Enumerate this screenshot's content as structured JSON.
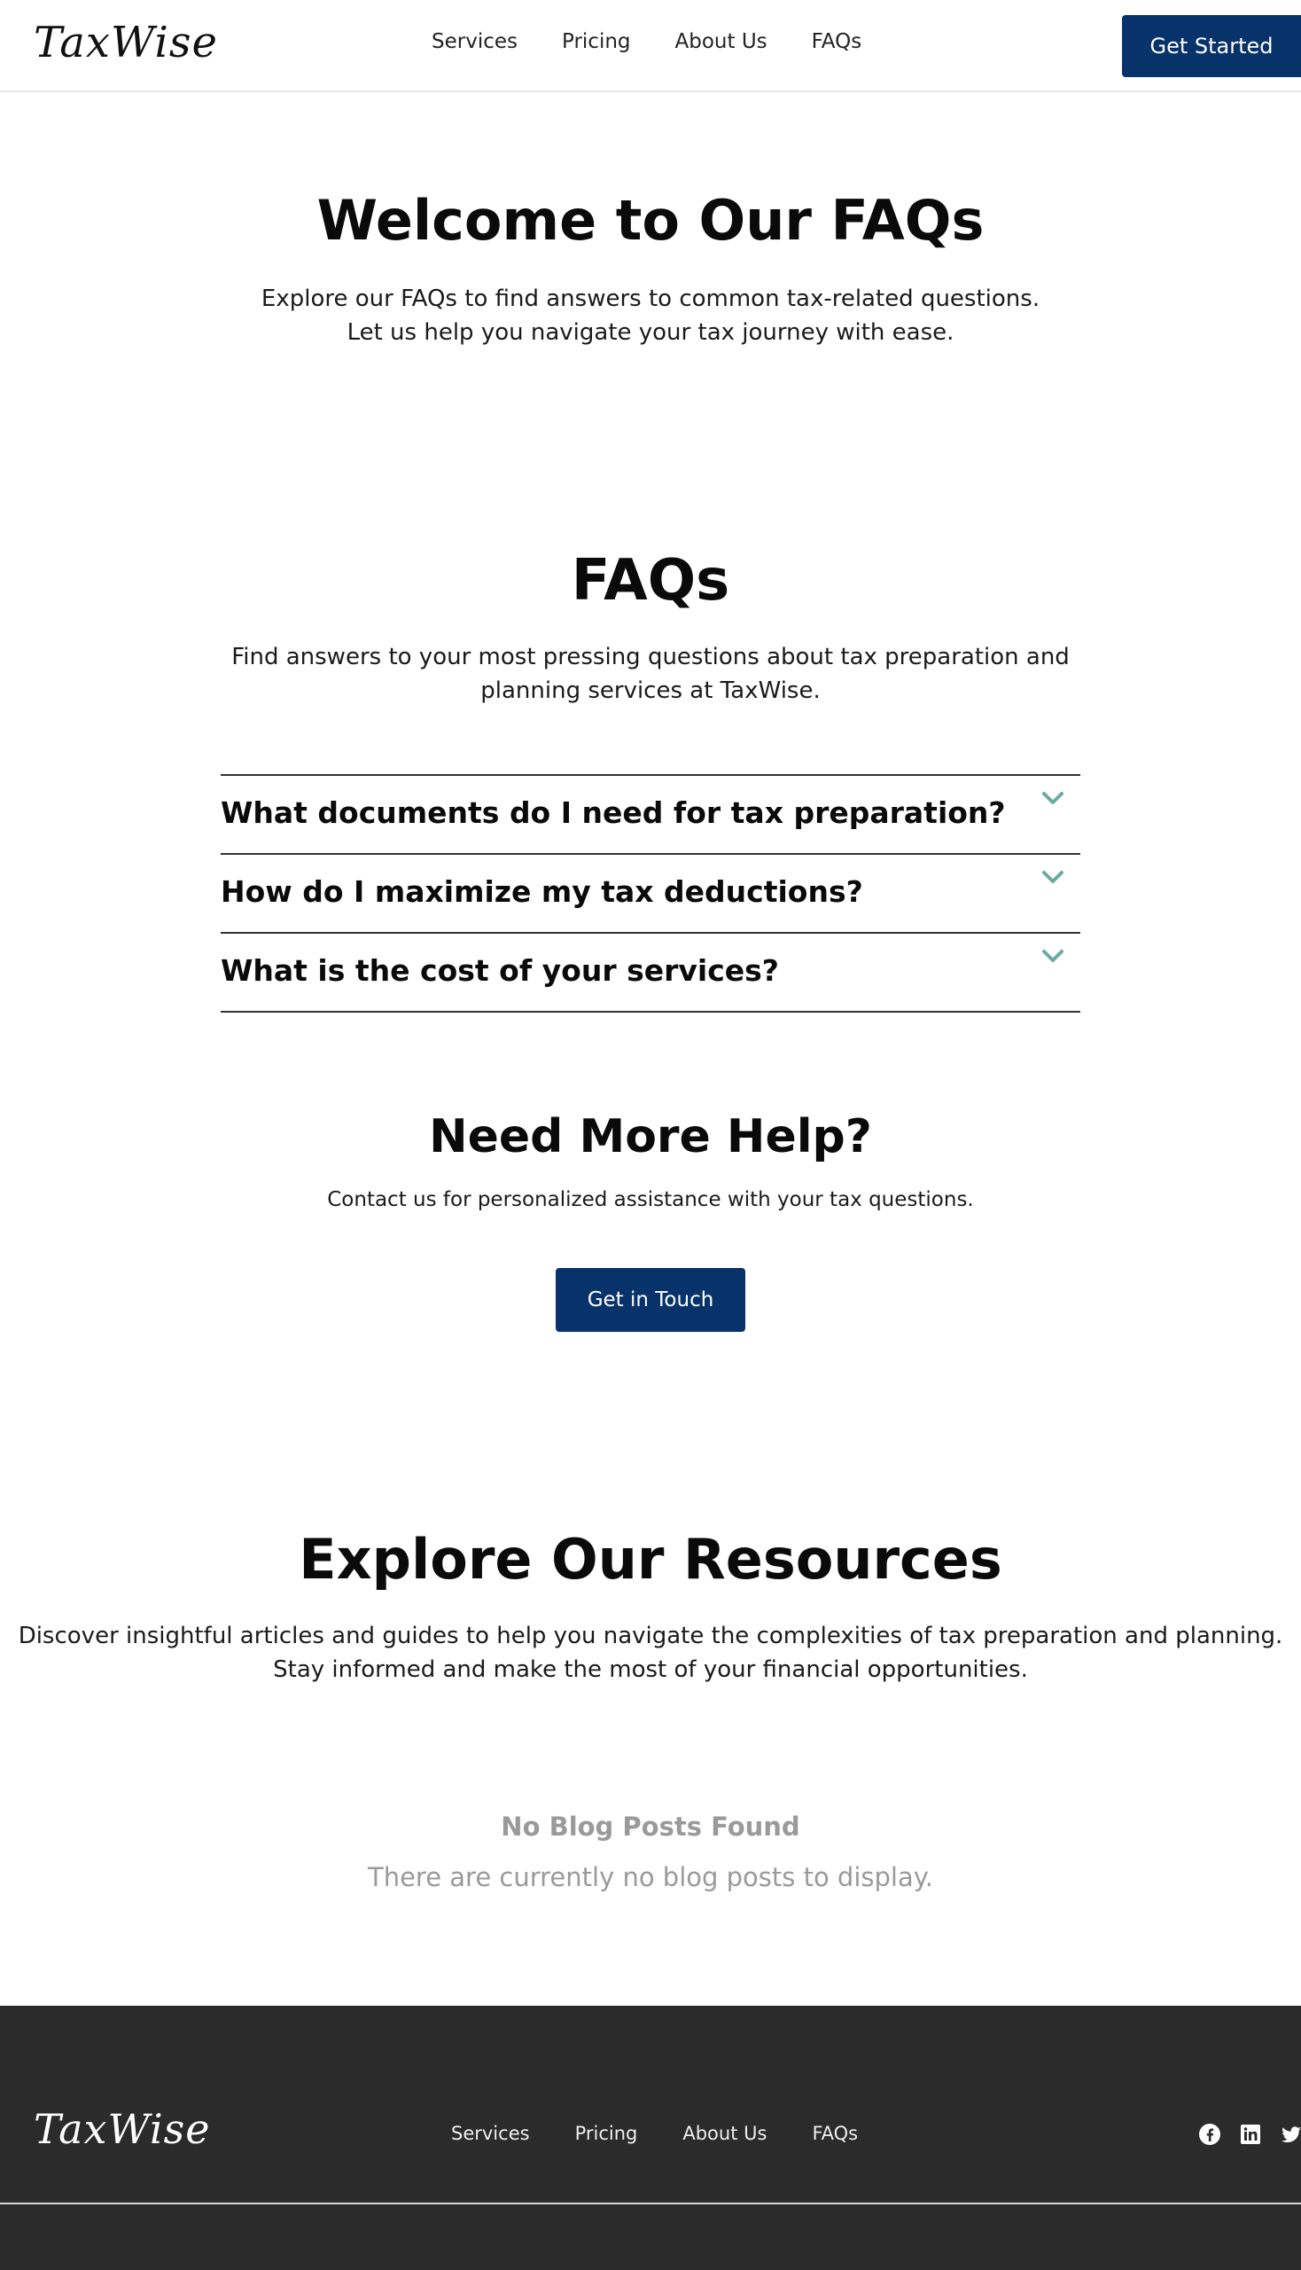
{
  "header": {
    "logo": "TaxWise",
    "nav": [
      "Services",
      "Pricing",
      "About Us",
      "FAQs"
    ],
    "cta": "Get Started"
  },
  "hero": {
    "title": "Welcome to Our FAQs",
    "text": "Explore our FAQs to find answers to common tax-related questions. Let us help you navigate your tax journey with ease."
  },
  "faqs": {
    "title": "FAQs",
    "subtitle": "Find answers to your most pressing questions about tax preparation and planning services at TaxWise.",
    "items": [
      {
        "question": "What documents do I need for tax preparation?"
      },
      {
        "question": "How do I maximize my tax deductions?"
      },
      {
        "question": "What is the cost of your services?"
      }
    ]
  },
  "help": {
    "title": "Need More Help?",
    "text": "Contact us for personalized assistance with your tax questions.",
    "button": "Get in Touch"
  },
  "resources": {
    "title": "Explore Our Resources",
    "text": "Discover insightful articles and guides to help you navigate the complexities of tax preparation and planning. Stay informed and make the most of your financial opportunities.",
    "empty_title": "No Blog Posts Found",
    "empty_text": "There are currently no blog posts to display."
  },
  "footer": {
    "logo": "TaxWise",
    "nav": [
      "Services",
      "Pricing",
      "About Us",
      "FAQs"
    ],
    "social_icons": [
      "facebook-icon",
      "linkedin-icon",
      "twitter-icon"
    ]
  },
  "colors": {
    "brand_navy": "#08326a",
    "accent_teal": "#6aab9f",
    "footer_bg": "#2b2b2b"
  }
}
